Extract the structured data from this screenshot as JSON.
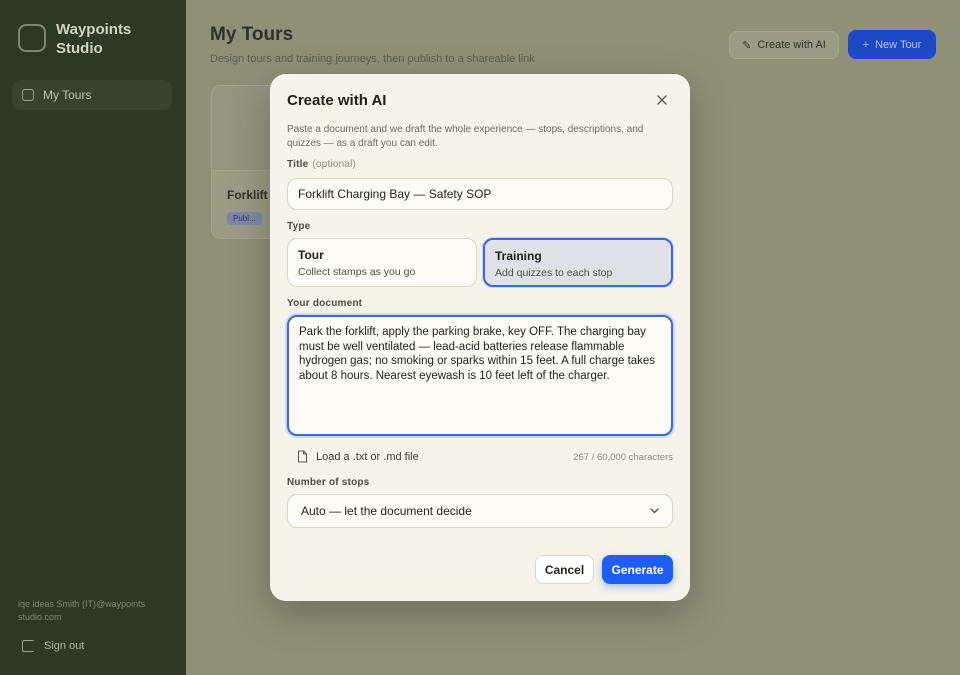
{
  "app": {
    "name": "Waypoints Studio",
    "sidebar": {
      "items": [
        {
          "label": "My Tours",
          "icon": "grid-icon"
        }
      ],
      "footer": "iqe ideas Smith (IT)@waypoints studio.com",
      "sign_out": "Sign out"
    },
    "header": {
      "title": "My Tours",
      "subtitle": "Design tours and training journeys, then publish to a shareable link",
      "create_ai": "Create with AI",
      "new_tour": "New Tour"
    },
    "card": {
      "title": "Forklift",
      "badge": "Publ..."
    }
  },
  "modal": {
    "title": "Create with AI",
    "intro": "Paste a document and we draft the whole experience — stops, descriptions, and quizzes — as a draft you can edit.",
    "title_field": {
      "label": "Title",
      "optional": "(optional)",
      "value": "Forklift Charging Bay — Safety SOP"
    },
    "type": {
      "label": "Type",
      "options": [
        {
          "name": "Tour",
          "desc": "Collect stamps as you go",
          "selected": false
        },
        {
          "name": "Training",
          "desc": "Add quizzes to each stop",
          "selected": true
        }
      ]
    },
    "document": {
      "label": "Your document",
      "value": "Park the forklift, apply the parking brake, key OFF. The charging bay must be well ventilated — lead-acid batteries release flammable hydrogen gas; no smoking or sparks within 15 feet. A full charge takes about 8 hours. Nearest eyewash is 10 feet left of the charger."
    },
    "load_file": "Load a .txt or .md file",
    "char_count": "267 / 60,000 characters",
    "stops": {
      "label": "Number of stops",
      "selected": "Auto — let the document decide"
    },
    "cancel": "Cancel",
    "generate": "Generate"
  },
  "colors": {
    "accent": "#1e5ef5",
    "selected_border": "#3c68dc",
    "modal_bg": "#f5f3ea",
    "sidebar_bg": "#2d3826"
  }
}
